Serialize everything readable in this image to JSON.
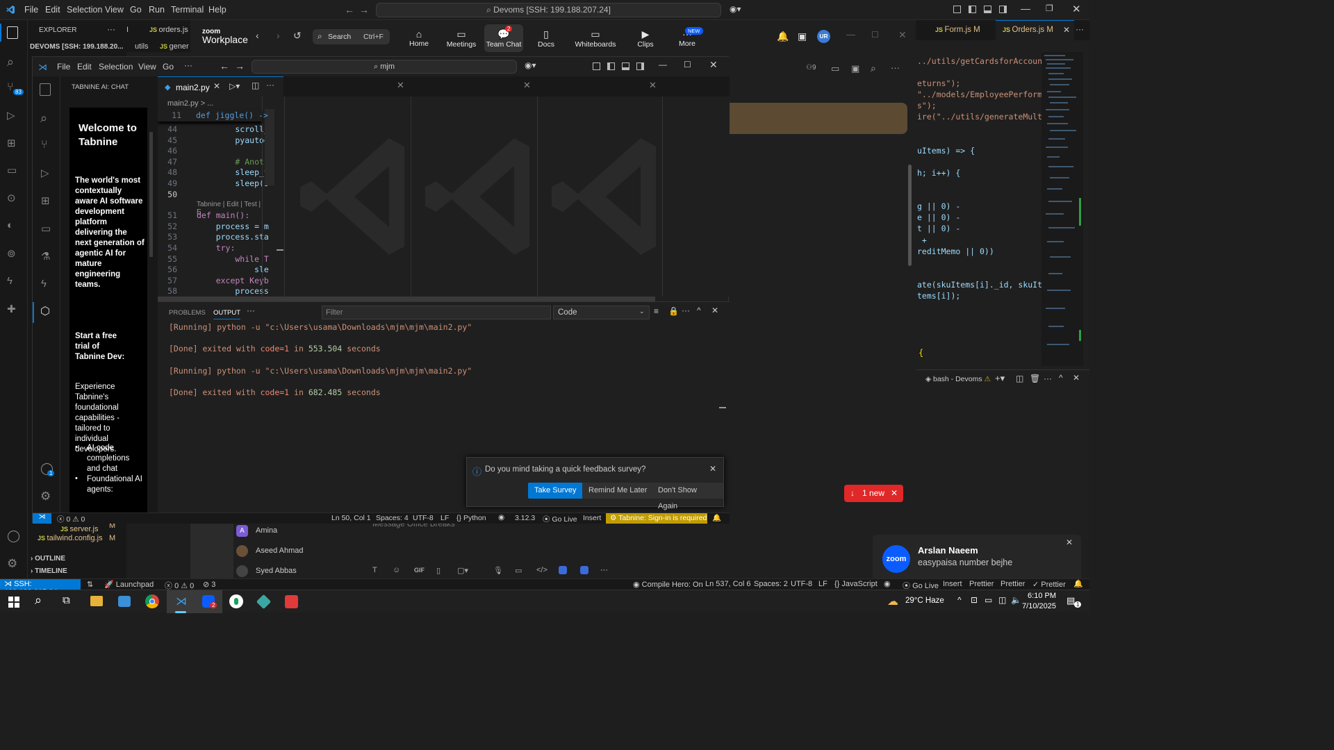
{
  "outer": {
    "menu": [
      "File",
      "Edit",
      "Selection",
      "View",
      "Go",
      "Run",
      "Terminal",
      "Help"
    ],
    "command_center": "Devoms [SSH: 199.188.207.24]",
    "explorer": {
      "title": "EXPLORER",
      "root": "DEVOMS [SSH: 199.188.20...",
      "item1": "utils",
      "item2": "gener",
      "server": "server.js",
      "tailwind": "tailwind.config.js",
      "mod": "M",
      "outline": "OUTLINE",
      "timeline": "TIMELINE"
    },
    "tabs": {
      "orders_top": "orders.js",
      "form": "Form.js",
      "orders": "Orders.js",
      "mod": "M"
    },
    "badges": {
      "source_control": "83"
    },
    "code": [
      "../utils/getCardsforAccount\")",
      "",
      "eturns\");",
      "\"../models/EmployeePerforman",
      "s\");",
      "ire(\"../utils/generateMultipl",
      "",
      "",
      "uItems) => {",
      "",
      "h; i++) {",
      "",
      "",
      "g || 0) -",
      "e || 0) -",
      "t || 0) -",
      " +",
      "reditMemo || 0))",
      "",
      "",
      "ate(skuItems[i]._id, skuItems",
      "tems[i]);"
    ],
    "code_brace": "{",
    "new_badge": "1 new",
    "terminal": "bash - Devoms",
    "status": {
      "ssh": "SSH: 199.188.207.24",
      "launchpad": "Launchpad",
      "problems": "0",
      "warnings": "0",
      "ports": "3",
      "compile": "Compile Hero: On",
      "pos": "Ln 537, Col 6",
      "spaces": "Spaces: 2",
      "enc": "UTF-8",
      "eol": "LF",
      "lang": "JavaScript",
      "golive": "Go Live",
      "insert": "Insert",
      "prettier1": "Prettier",
      "prettier2": "Prettier",
      "prettier3": "Prettier"
    }
  },
  "zoom": {
    "logo_top": "zoom",
    "logo_bottom": "Workplace",
    "search": "Search",
    "shortcut": "Ctrl+F",
    "nav": [
      {
        "label": "Home"
      },
      {
        "label": "Meetings"
      },
      {
        "label": "Team Chat",
        "badge": "2"
      },
      {
        "label": "Docs"
      },
      {
        "label": "Whiteboards"
      },
      {
        "label": "Clips"
      },
      {
        "label": "More",
        "badge": "NEW"
      }
    ],
    "avatar": "UR",
    "header_count": "9",
    "contacts": [
      {
        "name": "Amina",
        "initial": "A"
      },
      {
        "name": "Aseed Ahmad"
      },
      {
        "name": "Syed Abbas"
      }
    ],
    "message_placeholder": "Message Office Breaks",
    "toolbar": {
      "gif": "GIF"
    },
    "notification": {
      "sender": "Arslan Naeem",
      "message": "easypaisa number bejhe",
      "logo": "zoom"
    }
  },
  "inner": {
    "menu": [
      "File",
      "Edit",
      "Selection",
      "View",
      "Go"
    ],
    "search": "mjm",
    "side_title": "TABNINE AI: CHAT",
    "tab": "main2.py",
    "breadcrumb": "main2.py > ...",
    "sticky": {
      "num": "11",
      "text": "def jiggle() ->"
    },
    "codelens": "Tabnine | Edit | Test | E",
    "lines": [
      {
        "n": "44",
        "t": "        scroll_"
      },
      {
        "n": "45",
        "t": "        pyautog"
      },
      {
        "n": "46",
        "t": ""
      },
      {
        "n": "47",
        "t": "        # Anoth"
      },
      {
        "n": "48",
        "t": "        sleep_t"
      },
      {
        "n": "49",
        "t": "        sleep(s"
      },
      {
        "n": "50",
        "t": ""
      },
      {
        "n": "51",
        "t": "def main():"
      },
      {
        "n": "52",
        "t": "    process = m"
      },
      {
        "n": "53",
        "t": "    process.sta"
      },
      {
        "n": "54",
        "t": "    try:"
      },
      {
        "n": "55",
        "t": "        while T"
      },
      {
        "n": "56",
        "t": "            sle"
      },
      {
        "n": "57",
        "t": "    except Keyb"
      },
      {
        "n": "58",
        "t": "        process"
      }
    ],
    "tabnine": {
      "welcome": "Welcome to Tabnine",
      "desc": "The world's most contextually aware AI software development platform delivering the next generation of agentic AI for mature engineering teams.",
      "trial": "Start a free trial of Tabnine Dev:",
      "exp": "Experience Tabnine's foundational capabilities - tailored to individual developers.",
      "bullet1": "AI code completions and chat",
      "bullet2": "Foundational AI agents:"
    },
    "panel": {
      "problems": "PROBLEMS",
      "output": "OUTPUT",
      "filter": "Filter",
      "select": "Code"
    },
    "output": [
      {
        "type": "run",
        "text": "[Running] python -u \"c:\\Users\\usama\\Downloads\\mjm\\mjm\\main2.py\""
      },
      {
        "type": "done",
        "pre": "[Done] exited with ",
        "code": "code=1",
        "mid": " in ",
        "num": "553.504",
        "post": " seconds"
      },
      {
        "type": "run",
        "text": "[Running] python -u \"c:\\Users\\usama\\Downloads\\mjm\\mjm\\main2.py\""
      },
      {
        "type": "done",
        "pre": "[Done] exited with ",
        "code": "code=1",
        "mid": " in ",
        "num": "682.485",
        "post": " seconds"
      }
    ],
    "survey": {
      "question": "Do you mind taking a quick feedback survey?",
      "take": "Take Survey",
      "remind": "Remind Me Later",
      "dont": "Don't Show Again"
    },
    "status": {
      "errors": "0",
      "warnings": "0",
      "pos": "Ln 50, Col 1",
      "spaces": "Spaces: 4",
      "enc": "UTF-8",
      "eol": "LF",
      "lang": "Python",
      "ver": "3.12.3",
      "golive": "Go Live",
      "insert": "Insert",
      "tabnine": "Tabnine: Sign-in is required"
    },
    "account_badge": "1"
  },
  "taskbar": {
    "weather": "29°C Haze",
    "time": "6:10 PM",
    "date": "7/10/2025",
    "notif": "1",
    "zoom_badge": "2"
  },
  "colors": {
    "accent": "#0078d4",
    "zoom_blue": "#0b5cff",
    "error": "#f14c4c",
    "tabnine_yellow": "#c19c00",
    "output_red": "#f48771",
    "output_num": "#b5cea8"
  }
}
